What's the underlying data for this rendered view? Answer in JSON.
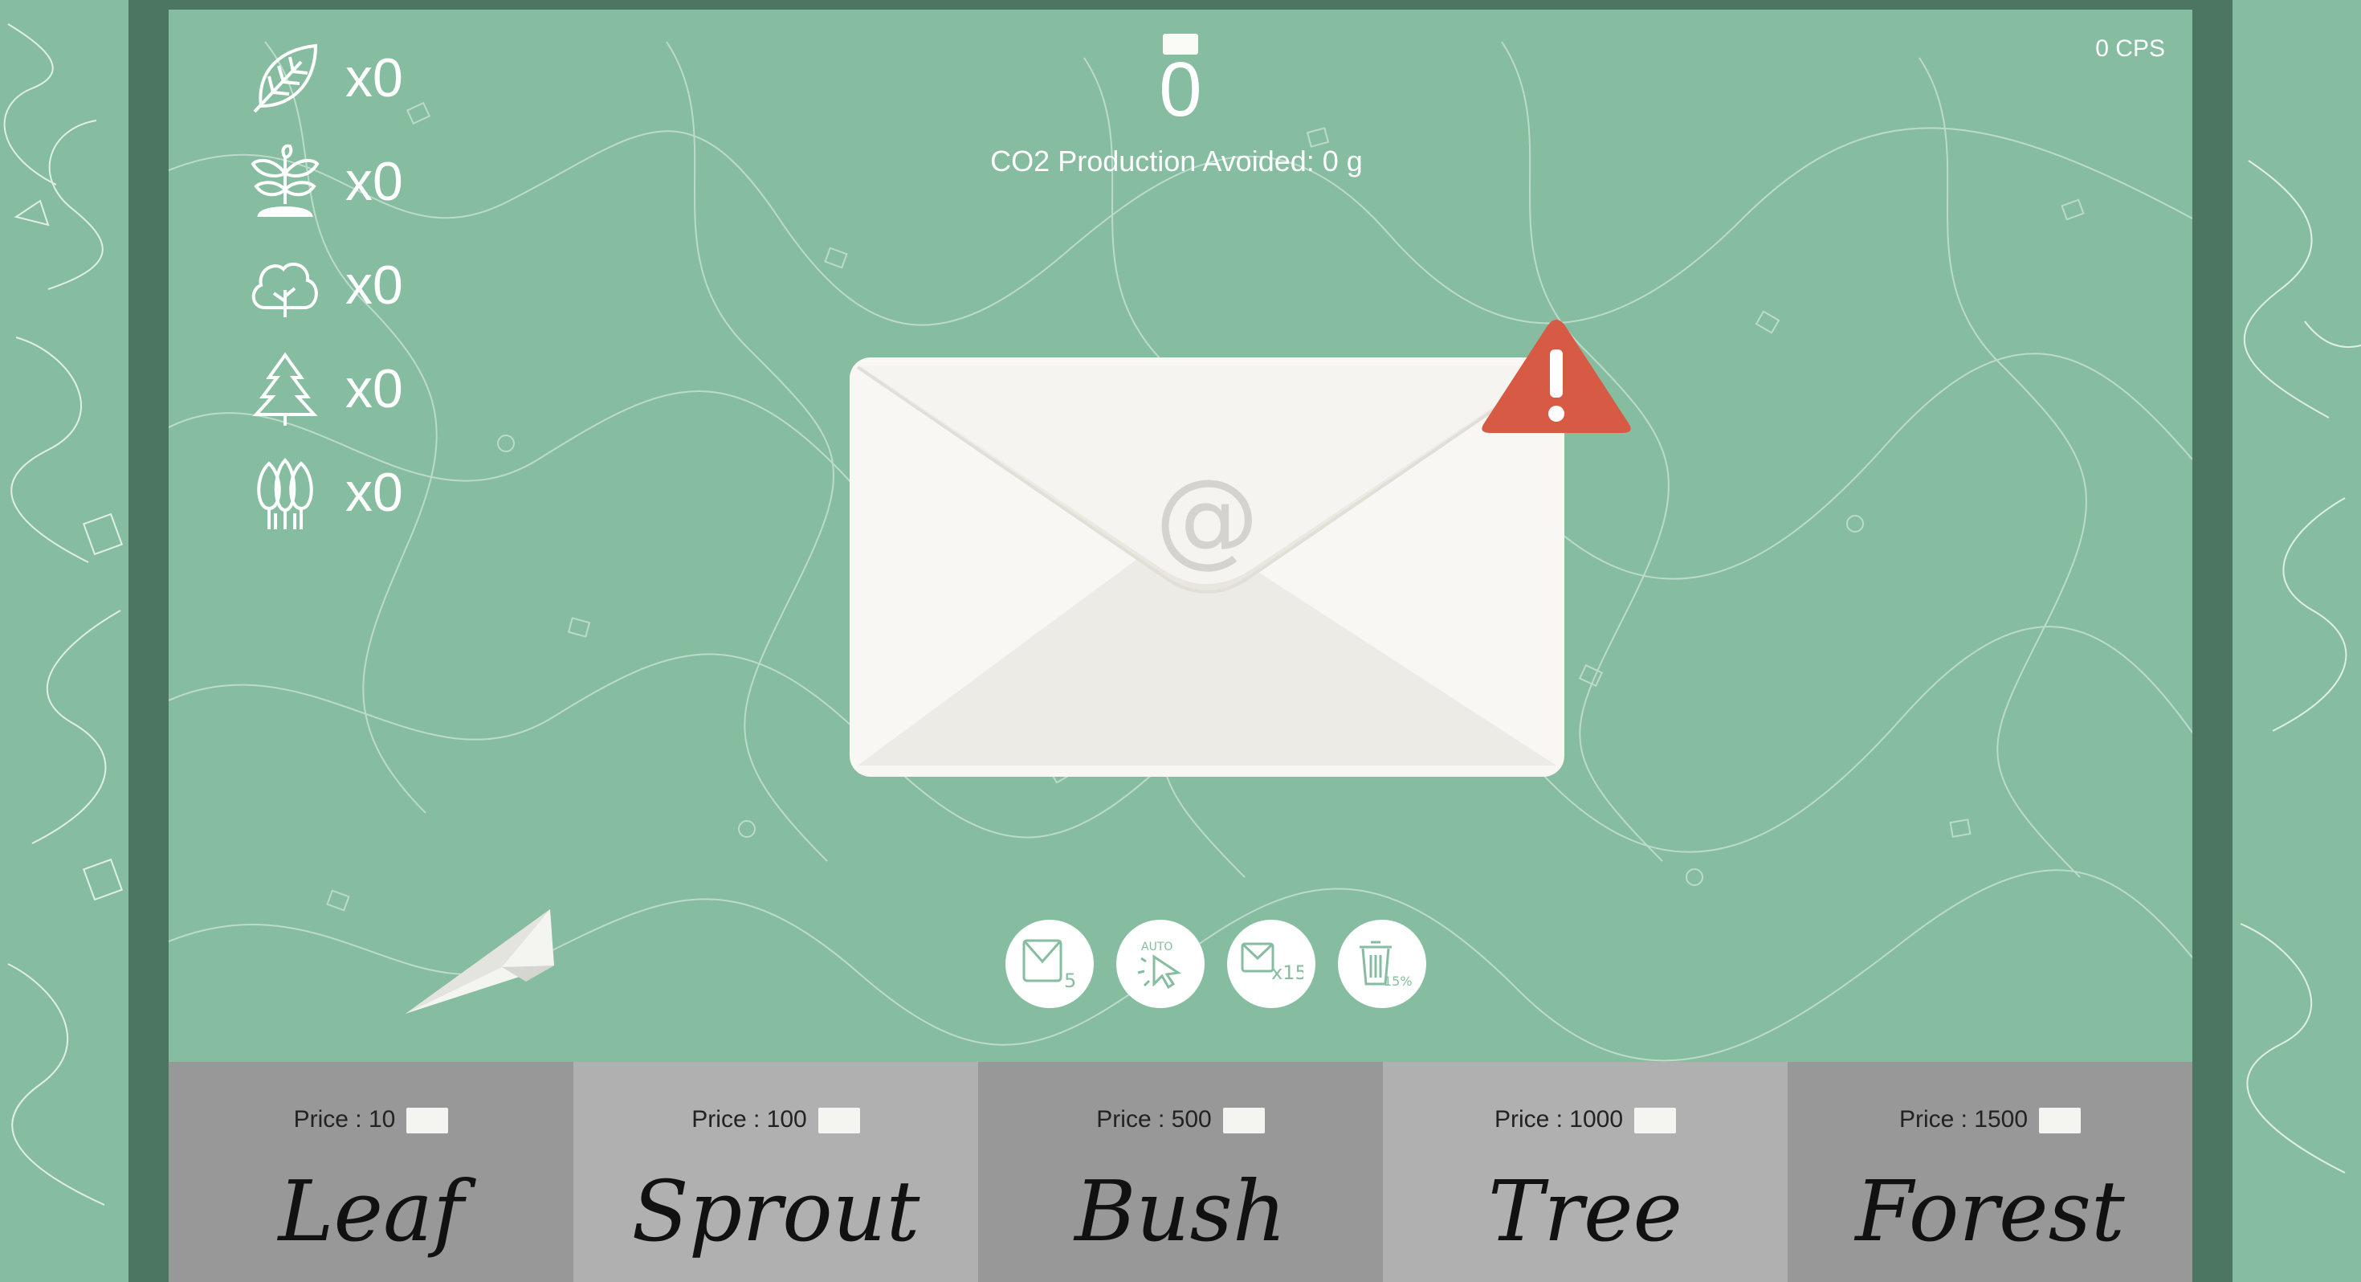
{
  "counter": {
    "value": "0",
    "icon": "envelope-icon"
  },
  "co2": {
    "label": "CO2 Production Avoided:",
    "value": "0 g"
  },
  "cps": "0 CPS",
  "inventory": [
    {
      "icon": "leaf-icon",
      "count": "x0"
    },
    {
      "icon": "sprout-icon",
      "count": "x0"
    },
    {
      "icon": "bush-icon",
      "count": "x0"
    },
    {
      "icon": "tree-icon",
      "count": "x0"
    },
    {
      "icon": "forest-icon",
      "count": "x0"
    }
  ],
  "powerups": [
    {
      "icon": "mail-x5-icon",
      "label": "5"
    },
    {
      "icon": "auto-click-icon",
      "label": "AUTO"
    },
    {
      "icon": "mail-x15-icon",
      "label": "x15"
    },
    {
      "icon": "trash-15-percent-icon",
      "label": "15%"
    }
  ],
  "shop": [
    {
      "price_label": "Price : 10",
      "name": "Leaf"
    },
    {
      "price_label": "Price : 100",
      "name": "Sprout"
    },
    {
      "price_label": "Price : 500",
      "name": "Bush"
    },
    {
      "price_label": "Price : 1000",
      "name": "Tree"
    },
    {
      "price_label": "Price : 1500",
      "name": "Forest"
    }
  ],
  "colors": {
    "background": "#86bda0",
    "frame": "#4c7562",
    "alert": "#d65a44",
    "shop_dark": "#989898",
    "shop_light": "#b0b0b0"
  }
}
